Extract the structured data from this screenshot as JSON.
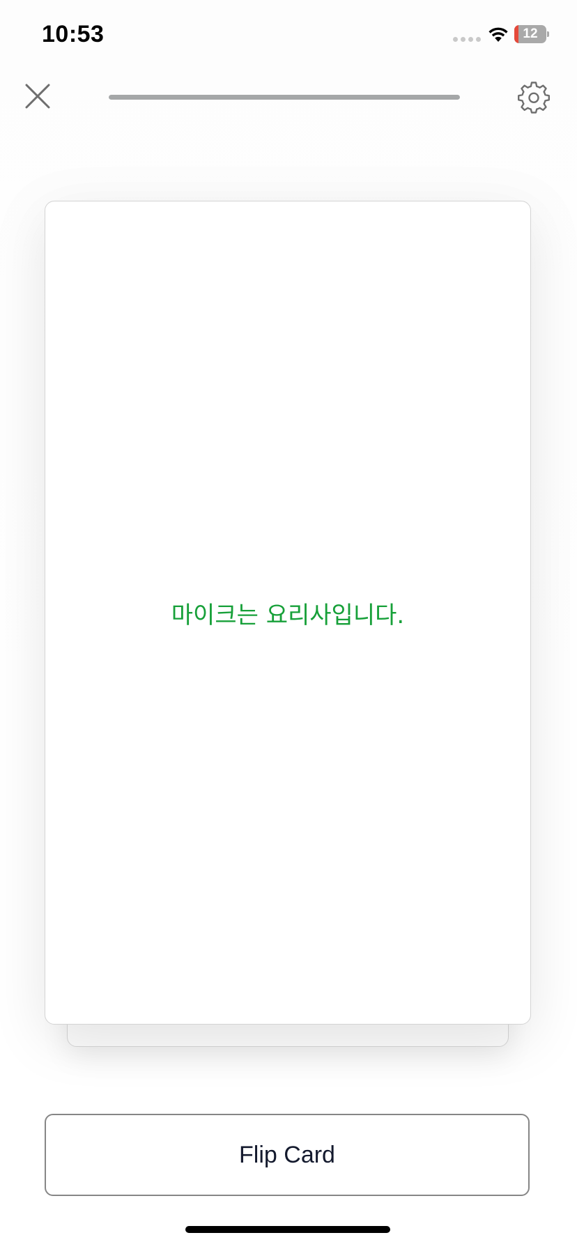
{
  "status_bar": {
    "time": "10:53",
    "battery_level": "12",
    "battery_fraction": 0.12,
    "icons": [
      "signal-dots-icon",
      "wifi-icon",
      "battery-charging-icon"
    ]
  },
  "toolbar": {
    "close_icon": "close-icon",
    "settings_icon": "gear-icon",
    "progress_fraction": 1.0
  },
  "card": {
    "front_text": "마이크는 요리사입니다."
  },
  "actions": {
    "flip_label": "Flip Card"
  },
  "colors": {
    "card_text": "#17a039",
    "progress": "#a5a7a8",
    "battery_low": "#e5493a"
  }
}
